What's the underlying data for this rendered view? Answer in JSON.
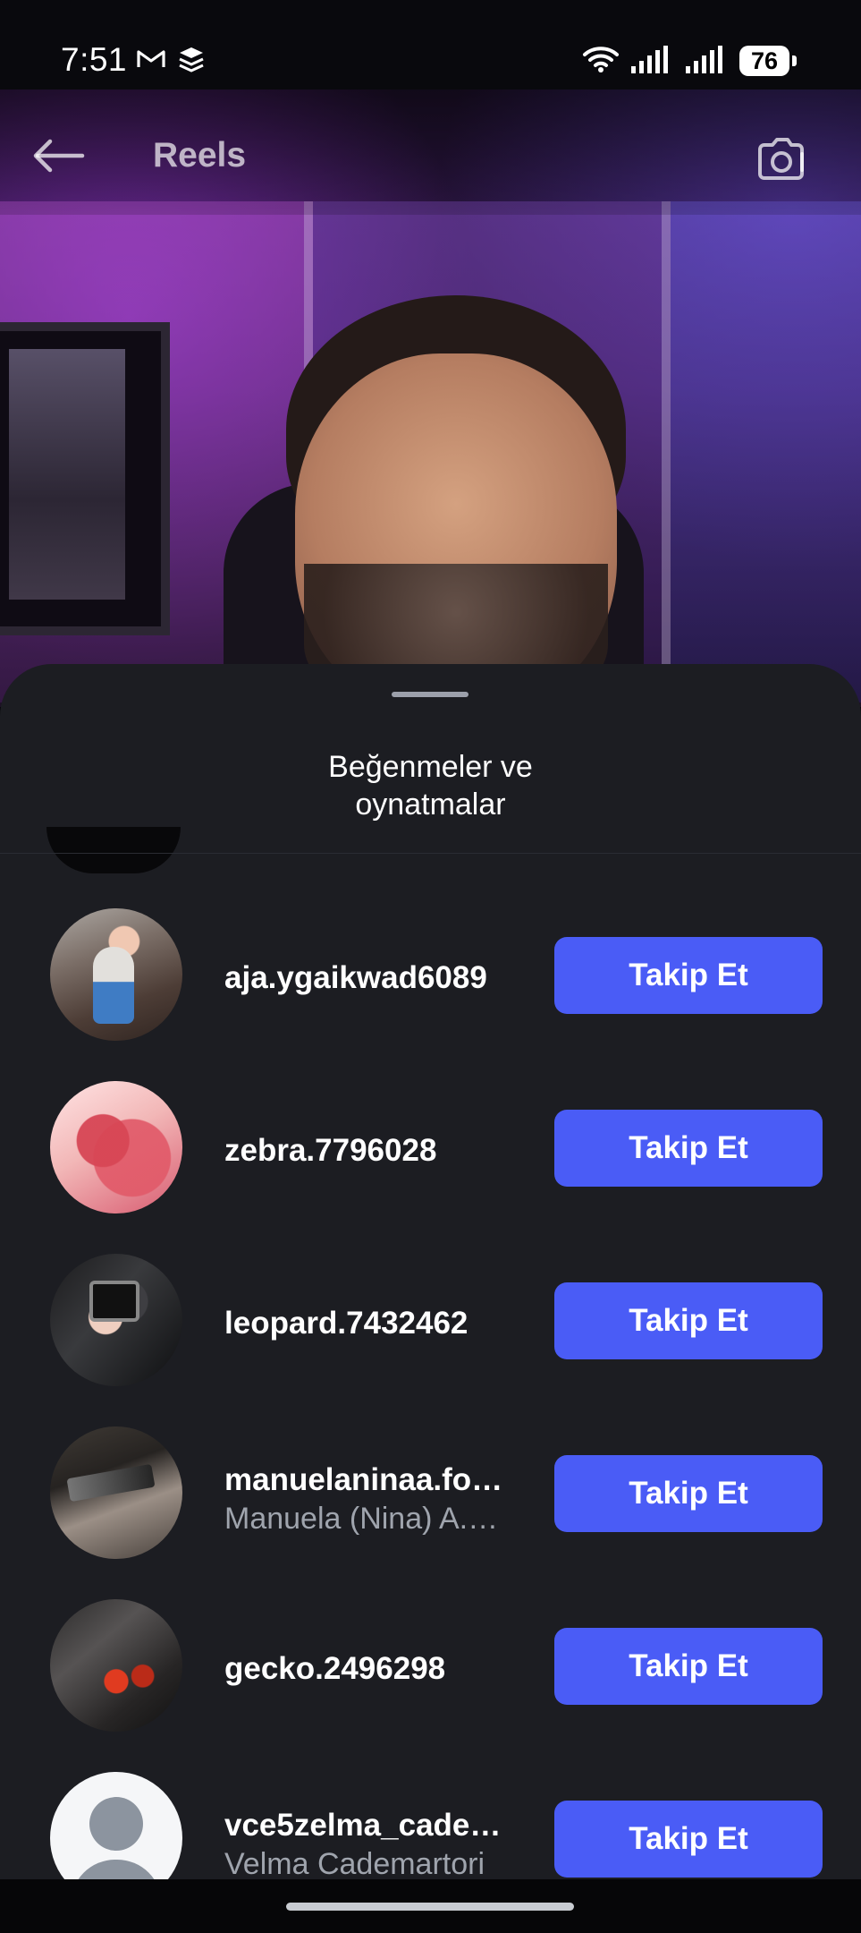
{
  "status_bar": {
    "time": "7:51",
    "battery": "76"
  },
  "header": {
    "title": "Reels"
  },
  "sheet": {
    "title": "Beğenmeler ve\noynatmalar"
  },
  "likers": [
    {
      "username": "aja.ygaikwad6089",
      "full_name": "",
      "button_label": "Takip Et"
    },
    {
      "username": "zebra.7796028",
      "full_name": "",
      "button_label": "Takip Et"
    },
    {
      "username": "leopard.7432462",
      "full_name": "",
      "button_label": "Takip Et"
    },
    {
      "username": "manuelaninaa.fo…",
      "full_name": "Manuela (Nina) A.…",
      "button_label": "Takip Et"
    },
    {
      "username": "gecko.2496298",
      "full_name": "",
      "button_label": "Takip Et"
    },
    {
      "username": "vce5zelma_cade…",
      "full_name": "Velma Cademartori",
      "button_label": "Takip Et"
    }
  ],
  "colors": {
    "sheet_background": "#1c1d22",
    "follow_button": "#4a5cf6",
    "secondary_text": "#9fa4ad"
  },
  "icons": {
    "back": "back-arrow-icon",
    "camera": "camera-icon",
    "wifi": "wifi-icon",
    "signal": "signal-icon",
    "battery": "battery-icon",
    "gmail": "gmail-icon",
    "stack": "stack-icon"
  }
}
